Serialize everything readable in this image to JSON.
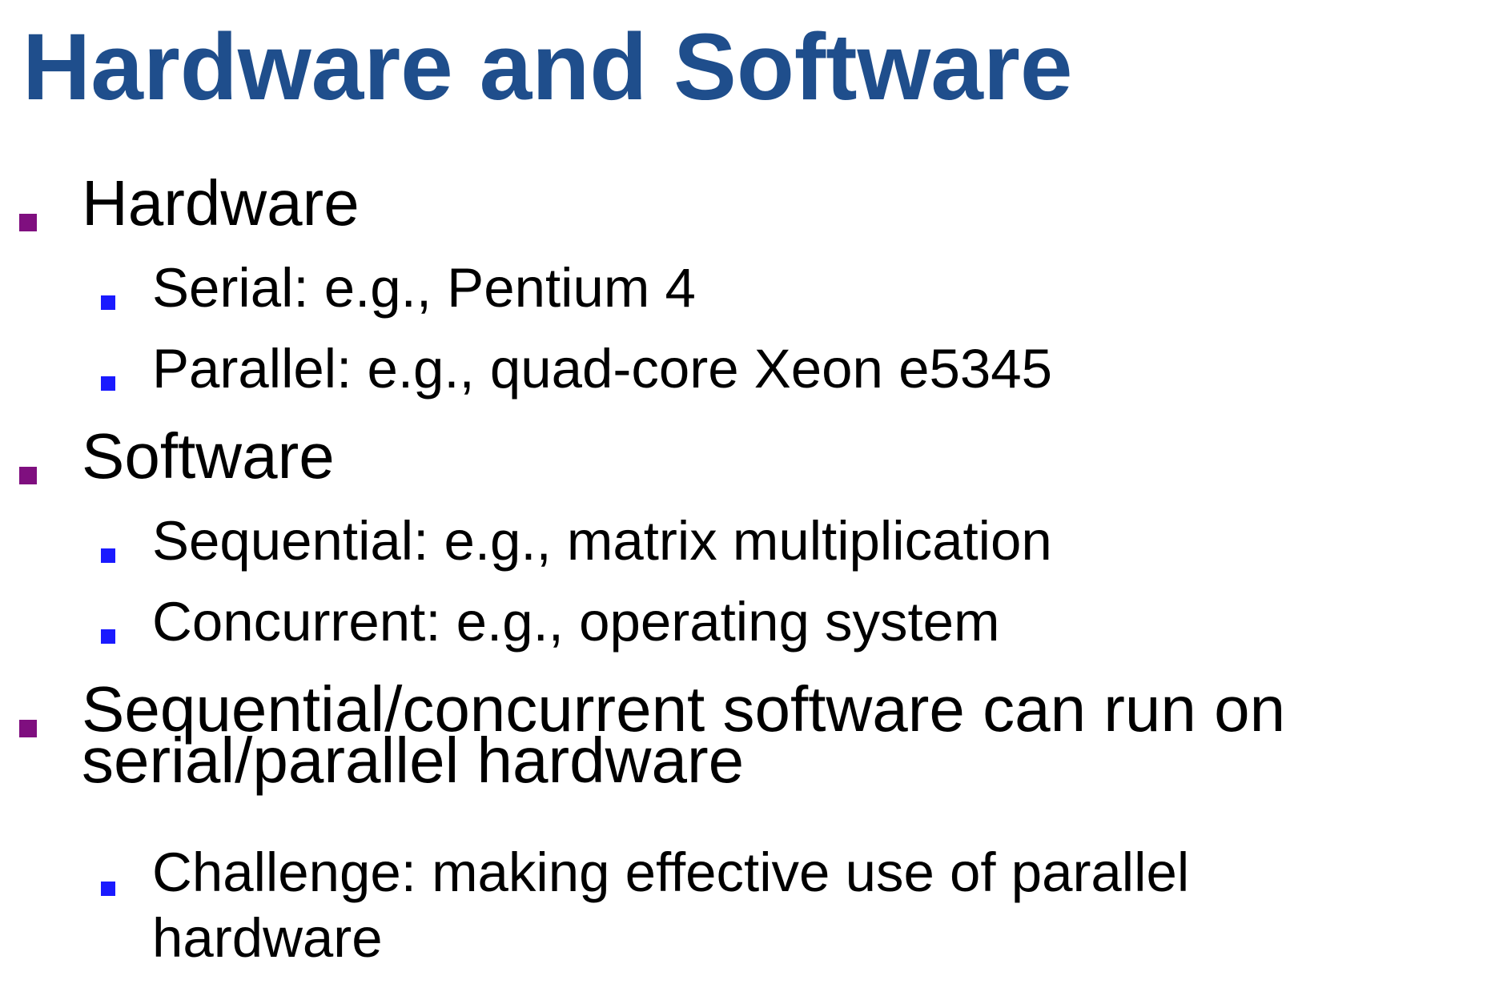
{
  "slide": {
    "title": "Hardware and Software",
    "items": [
      {
        "text": "Hardware",
        "children": [
          {
            "text": "Serial: e.g., Pentium 4"
          },
          {
            "text": "Parallel: e.g., quad-core Xeon e5345"
          }
        ]
      },
      {
        "text": "Software",
        "children": [
          {
            "text": "Sequential: e.g., matrix multiplication"
          },
          {
            "text": "Concurrent: e.g., operating system"
          }
        ]
      },
      {
        "text_line1": "Sequential/concurrent software can run on",
        "text_line2": "serial/parallel hardware",
        "children": [
          {
            "text_line1": "Challenge: making effective use of parallel",
            "text_line2": "hardware"
          }
        ]
      }
    ],
    "colors": {
      "title": "#1f4e8c",
      "bullet_level1": "#7f0f7f",
      "bullet_level2": "#1a1aff",
      "text": "#000000",
      "background": "#ffffff"
    }
  }
}
